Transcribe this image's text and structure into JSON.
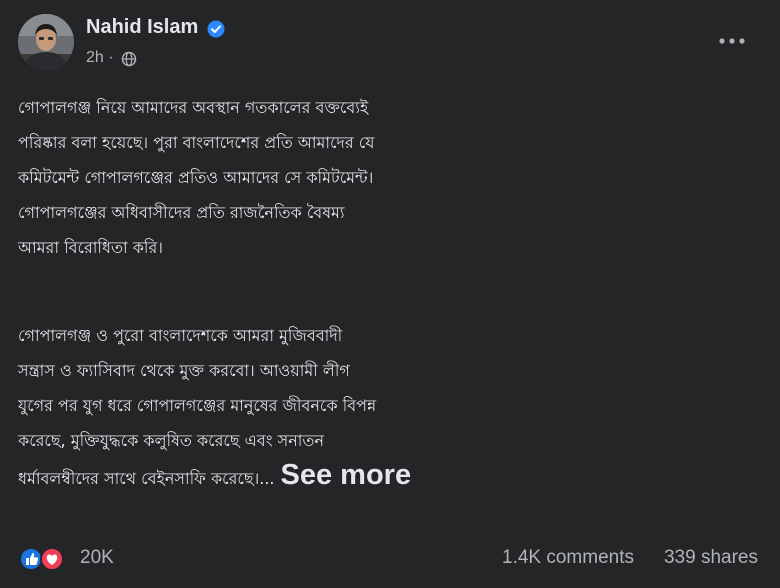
{
  "post": {
    "author": "Nahid Islam",
    "time": "2h",
    "separator": "·",
    "paragraphs": [
      {
        "lines": [
          "গোপালগঞ্জ নিয়ে আমাদের অবস্থান গতকালের বক্তব্যেই",
          "পরিষ্কার বলা হয়েছে। পুরা বাংলাদেশের প্রতি আমাদের যে",
          "কমিটমেন্ট গোপালগঞ্জের প্রতিও আমাদের সে কমিটমেন্ট।",
          "গোপালগঞ্জের অধিবাসীদের প্রতি রাজনৈতিক বৈষম্য",
          "আমরা বিরোধিতা করি।"
        ]
      },
      {
        "lines": [
          "গোপালগঞ্জ ও পুরো বাংলাদেশকে আমরা মুজিববাদী",
          "সন্ত্রাস ও ফ্যাসিবাদ থেকে মুক্ত করবো। আওয়ামী লীগ",
          "যুগের পর যুগ ধরে গোপালগঞ্জের মানুষের জীবনকে বিপন্ন",
          "করেছে, মুক্তিযুদ্ধকে কলুষিত করেছে এবং সনাতন",
          "ধর্মাবলম্বীদের সাথে বেইনসাফি করেছে।..."
        ]
      }
    ],
    "see_more": "See more",
    "reaction_count": "20K",
    "comments": "1.4K comments",
    "shares": "339 shares",
    "icons": {
      "verified": "verified-badge-icon",
      "privacy": "globe-icon",
      "more": "more-options-icon",
      "like": "like-reaction-icon",
      "love": "love-reaction-icon"
    },
    "colors": {
      "background": "#242526",
      "text": "#e4e6eb",
      "secondary_text": "#b0b3b8",
      "verified": "#2d88ff",
      "like": "#1b74e4",
      "love": "#f33e58"
    }
  }
}
